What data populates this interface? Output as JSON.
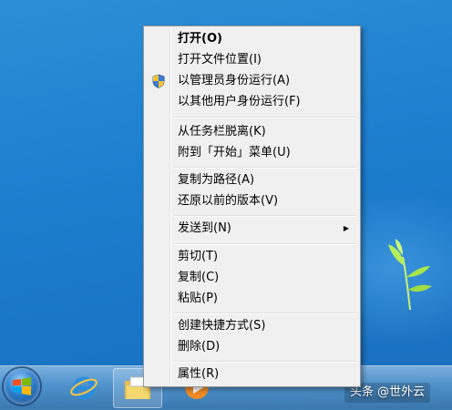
{
  "desktop": {
    "background_color": "#1d7fcf"
  },
  "context_menu": {
    "items": [
      {
        "label": "打开(O)"
      },
      {
        "label": "打开文件位置(I)"
      },
      {
        "label": "以管理员身份运行(A)",
        "icon": "uac-shield-icon"
      },
      {
        "label": "以其他用户身份运行(F)"
      },
      {
        "label": "从任务栏脱离(K)"
      },
      {
        "label": "附到「开始」菜单(U)"
      },
      {
        "label": "复制为路径(A)"
      },
      {
        "label": "还原以前的版本(V)"
      },
      {
        "label": "发送到(N)",
        "arrow": "▶"
      },
      {
        "label": "剪切(T)"
      },
      {
        "label": "复制(C)"
      },
      {
        "label": "粘贴(P)"
      },
      {
        "label": "创建快捷方式(S)"
      },
      {
        "label": "删除(D)"
      },
      {
        "label": "属性(R)"
      }
    ]
  },
  "taskbar": {
    "items": [
      {
        "icon": "windows-start-icon"
      },
      {
        "icon": "internet-explorer-icon"
      },
      {
        "icon": "file-explorer-folder-icon"
      },
      {
        "icon": "media-player-icon"
      }
    ]
  },
  "watermark": {
    "text": "头条 @世外云"
  }
}
